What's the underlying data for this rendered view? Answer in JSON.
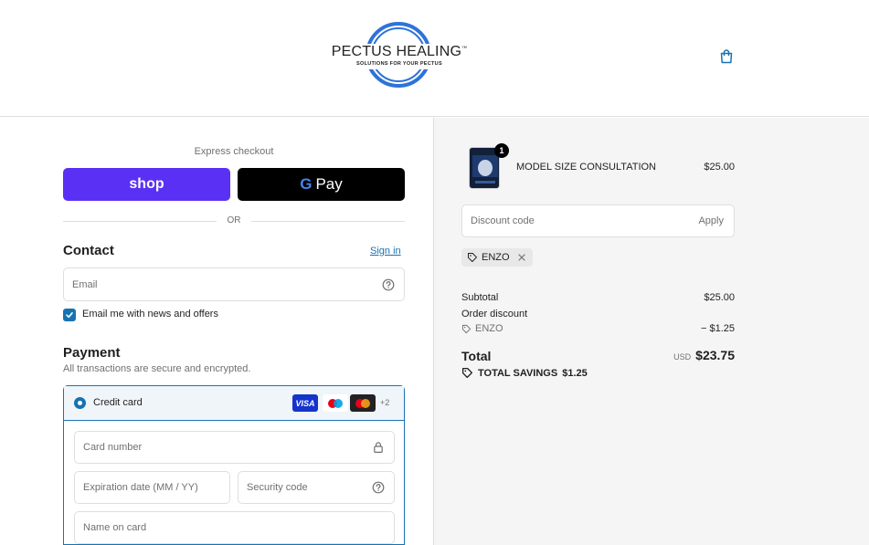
{
  "brand": {
    "name": "PECTUS HEALING",
    "trademark": "™",
    "tagline": "SOLUTIONS FOR YOUR PECTUS"
  },
  "colors": {
    "accent": "#1773b0",
    "shop_pay": "#5a31f4",
    "logo_blue": "#2d73d9"
  },
  "express": {
    "title": "Express checkout",
    "shop_label": "shop",
    "gpay_g": "G",
    "gpay_label": "Pay",
    "or_label": "OR"
  },
  "contact": {
    "heading": "Contact",
    "sign_in": "Sign in",
    "email_placeholder": "Email",
    "newsletter_label": "Email me with news and offers",
    "newsletter_checked": true
  },
  "payment": {
    "heading": "Payment",
    "subtitle": "All transactions are secure and encrypted.",
    "method_label": "Credit card",
    "card_brands": [
      "visa",
      "maestro",
      "mastercard"
    ],
    "visa_label": "VISA",
    "more_brands": "+2",
    "card_number_placeholder": "Card number",
    "expiry_placeholder": "Expiration date (MM / YY)",
    "security_placeholder": "Security code",
    "name_placeholder": "Name on card"
  },
  "order": {
    "item": {
      "quantity": "1",
      "title": "MODEL SIZE CONSULTATION",
      "price": "$25.00"
    },
    "discount_placeholder": "Discount code",
    "apply_label": "Apply",
    "applied_code": "ENZO",
    "subtotal_label": "Subtotal",
    "subtotal_value": "$25.00",
    "order_discount_label": "Order discount",
    "discount_code_label": "ENZO",
    "discount_value": "− $1.25",
    "total_label": "Total",
    "total_currency": "USD",
    "total_value": "$23.75",
    "savings_label": "TOTAL SAVINGS",
    "savings_value": "$1.25"
  },
  "icons": {
    "cart": "shopping-bag-icon",
    "help": "question-circle-icon",
    "lock": "lock-icon",
    "tag": "tag-icon",
    "remove": "close-icon"
  }
}
